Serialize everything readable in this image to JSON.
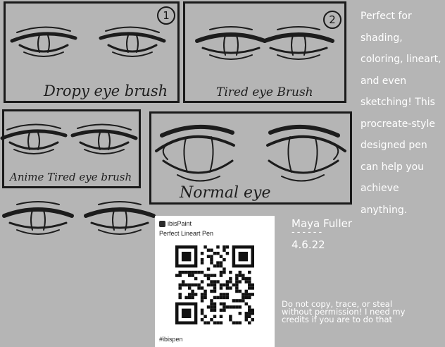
{
  "panels": [
    {
      "number": "1",
      "caption": "Dropy eye brush"
    },
    {
      "number": "2",
      "caption": "Tired eye Brush"
    },
    {
      "caption": "Anime Tired eye brush"
    },
    {
      "caption": "Normal eye"
    }
  ],
  "blurb": [
    "Perfect for",
    "shading,",
    "coloring, lineart,",
    "and even",
    "sketching! This",
    "procreate-style",
    "designed pen",
    "can help you",
    "achieve anything."
  ],
  "signature": {
    "name": "Maya Fuller",
    "divider": "------",
    "date": "4.6.22"
  },
  "qr_card": {
    "app": "ibisPaint",
    "title": "Perfect Lineart Pen",
    "tag": "#ibispen"
  },
  "notice": "Do not copy, trace, or steal without permission! I need my credits if you are to do that",
  "colors": {
    "background": "#b5b5b5",
    "ink": "#1c1c1c",
    "text_light": "#ffffff",
    "card": "#ffffff"
  }
}
